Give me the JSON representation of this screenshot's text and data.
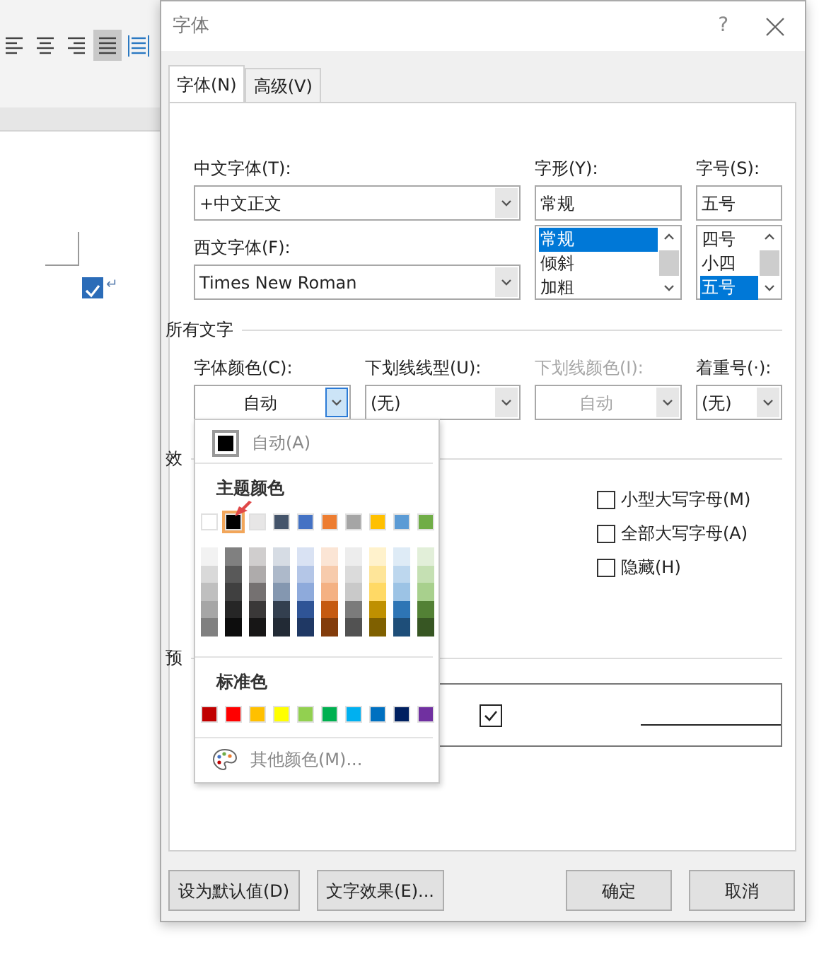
{
  "background": {
    "alignment_buttons": [
      {
        "kind": "left",
        "selected": false
      },
      {
        "kind": "center",
        "selected": false
      },
      {
        "kind": "right",
        "selected": false
      },
      {
        "kind": "justify",
        "selected": true
      },
      {
        "kind": "distributed",
        "selected": false
      }
    ],
    "document": {
      "checkbox_checked": true,
      "paragraph_mark": "↵"
    }
  },
  "window": {
    "title": "字体",
    "help": "?"
  },
  "tabs": [
    {
      "label": "字体(N)",
      "selected": true
    },
    {
      "label": "高级(V)",
      "selected": false
    }
  ],
  "fonts": {
    "chinese_font": {
      "label": "中文字体(T):",
      "value": "+中文正文"
    },
    "western_font": {
      "label": "西文字体(F):",
      "value": "Times New Roman"
    },
    "style": {
      "label": "字形(Y):",
      "value": "常规",
      "options": [
        {
          "label": "常规",
          "selected": true
        },
        {
          "label": "倾斜",
          "selected": false
        },
        {
          "label": "加粗",
          "selected": false
        }
      ]
    },
    "size": {
      "label": "字号(S):",
      "value": "五号",
      "options": [
        {
          "label": "四号",
          "selected": false
        },
        {
          "label": "小四",
          "selected": false
        },
        {
          "label": "五号",
          "selected": true
        }
      ]
    }
  },
  "all_text": {
    "heading": "所有文字",
    "fields": [
      {
        "label": "字体颜色(C):",
        "value": "自动",
        "centered": true,
        "disabled": false,
        "open": true
      },
      {
        "label": "下划线线型(U):",
        "value": "(无)",
        "centered": false,
        "disabled": false,
        "open": false
      },
      {
        "label": "下划线颜色(I):",
        "value": "自动",
        "centered": true,
        "disabled": true,
        "open": false
      },
      {
        "label": "着重号(·):",
        "value": "(无)",
        "centered": false,
        "disabled": false,
        "open": false
      }
    ]
  },
  "effects": {
    "heading": "效",
    "checkboxes": [
      {
        "label": "小型大写字母(M)",
        "checked": false
      },
      {
        "label": "全部大写字母(A)",
        "checked": false
      },
      {
        "label": "隐藏(H)",
        "checked": false
      }
    ]
  },
  "preview": {
    "heading": "预"
  },
  "color_menu": {
    "auto_label": "自动(A)",
    "theme_heading": "主题颜色",
    "theme_colors": [
      {
        "color": "#ffffff",
        "selected": false
      },
      {
        "color": "#000000",
        "selected": true
      },
      {
        "color": "#e7e6e6",
        "selected": false
      },
      {
        "color": "#44546a",
        "selected": false
      },
      {
        "color": "#4472c4",
        "selected": false
      },
      {
        "color": "#ed7d31",
        "selected": false
      },
      {
        "color": "#a5a5a5",
        "selected": false
      },
      {
        "color": "#ffc000",
        "selected": false
      },
      {
        "color": "#5b9bd5",
        "selected": false
      },
      {
        "color": "#70ad47",
        "selected": false
      }
    ],
    "shade_columns": [
      {
        "swatches": [
          {
            "color": "#f2f2f2"
          },
          {
            "color": "#d9d9d9"
          },
          {
            "color": "#bfbfbf"
          },
          {
            "color": "#a6a6a6"
          },
          {
            "color": "#808080"
          }
        ]
      },
      {
        "swatches": [
          {
            "color": "#808080"
          },
          {
            "color": "#595959"
          },
          {
            "color": "#404040"
          },
          {
            "color": "#262626"
          },
          {
            "color": "#0d0d0d"
          }
        ]
      },
      {
        "swatches": [
          {
            "color": "#d0cece"
          },
          {
            "color": "#aeabab"
          },
          {
            "color": "#757171"
          },
          {
            "color": "#3a3838"
          },
          {
            "color": "#171616"
          }
        ]
      },
      {
        "swatches": [
          {
            "color": "#d6dce4"
          },
          {
            "color": "#adb9ca"
          },
          {
            "color": "#8497b0"
          },
          {
            "color": "#333f4f"
          },
          {
            "color": "#222a35"
          }
        ]
      },
      {
        "swatches": [
          {
            "color": "#d9e2f3"
          },
          {
            "color": "#b4c6e7"
          },
          {
            "color": "#8eaadb"
          },
          {
            "color": "#2f5496"
          },
          {
            "color": "#1f3864"
          }
        ]
      },
      {
        "swatches": [
          {
            "color": "#fbe5d5"
          },
          {
            "color": "#f7cbac"
          },
          {
            "color": "#f4b183"
          },
          {
            "color": "#c55a11"
          },
          {
            "color": "#833c0b"
          }
        ]
      },
      {
        "swatches": [
          {
            "color": "#ededed"
          },
          {
            "color": "#dbdbdb"
          },
          {
            "color": "#c9c9c9"
          },
          {
            "color": "#7b7b7b"
          },
          {
            "color": "#525252"
          }
        ]
      },
      {
        "swatches": [
          {
            "color": "#fff2cc"
          },
          {
            "color": "#fee599"
          },
          {
            "color": "#ffd965"
          },
          {
            "color": "#bf9000"
          },
          {
            "color": "#7f6000"
          }
        ]
      },
      {
        "swatches": [
          {
            "color": "#deebf6"
          },
          {
            "color": "#bdd7ee"
          },
          {
            "color": "#9cc3e5"
          },
          {
            "color": "#2e75b5"
          },
          {
            "color": "#1e4e79"
          }
        ]
      },
      {
        "swatches": [
          {
            "color": "#e2efd9"
          },
          {
            "color": "#c5e0b3"
          },
          {
            "color": "#a8d08d"
          },
          {
            "color": "#538135"
          },
          {
            "color": "#375623"
          }
        ]
      }
    ],
    "standard_heading": "标准色",
    "standard_colors": [
      {
        "color": "#c00000"
      },
      {
        "color": "#ff0000"
      },
      {
        "color": "#ffc000"
      },
      {
        "color": "#ffff00"
      },
      {
        "color": "#92d050"
      },
      {
        "color": "#00b050"
      },
      {
        "color": "#00b0f0"
      },
      {
        "color": "#0070c0"
      },
      {
        "color": "#002060"
      },
      {
        "color": "#7030a0"
      }
    ],
    "more_label": "其他颜色(M)..."
  },
  "buttons_left": [
    {
      "label": "设为默认值(D)"
    },
    {
      "label": "文字效果(E)..."
    }
  ],
  "buttons_right": [
    {
      "label": "确定"
    },
    {
      "label": "取消"
    }
  ]
}
